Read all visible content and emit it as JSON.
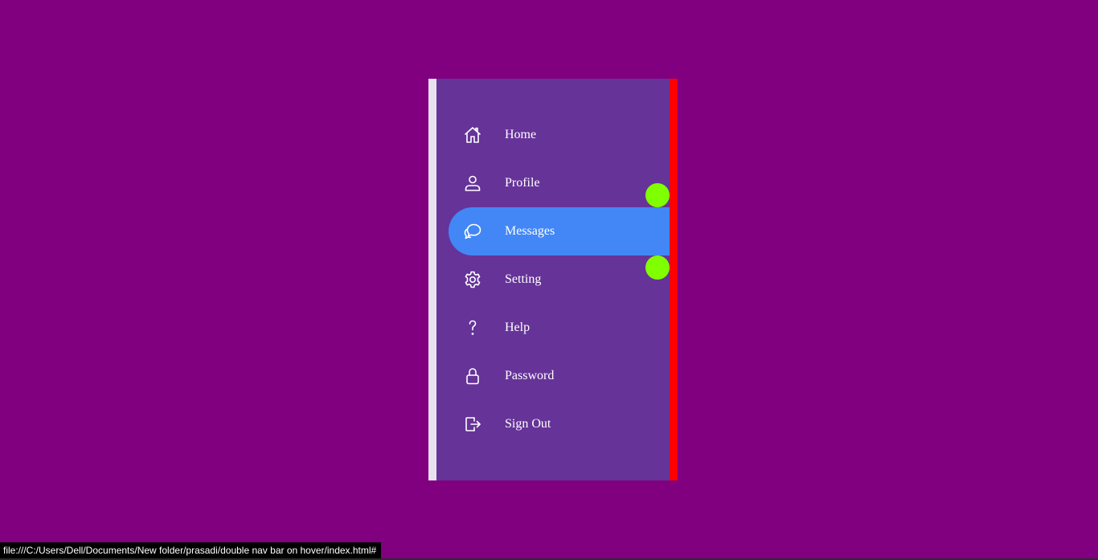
{
  "nav": {
    "items": [
      {
        "label": "Home",
        "icon": "home-icon"
      },
      {
        "label": "Profile",
        "icon": "user-icon"
      },
      {
        "label": "Messages",
        "icon": "chat-icon",
        "active": true
      },
      {
        "label": "Setting",
        "icon": "gear-icon"
      },
      {
        "label": "Help",
        "icon": "question-icon"
      },
      {
        "label": "Password",
        "icon": "lock-icon"
      },
      {
        "label": "Sign Out",
        "icon": "sign-out-icon"
      }
    ]
  },
  "status_bar": {
    "url": "file:///C:/Users/Dell/Documents/New folder/prasadi/double nav bar on hover/index.html#"
  },
  "colors": {
    "background": "#800080",
    "panel": "#663399",
    "active": "#4287f5",
    "accent_dot": "#7fff00",
    "right_border": "#ff0000"
  }
}
